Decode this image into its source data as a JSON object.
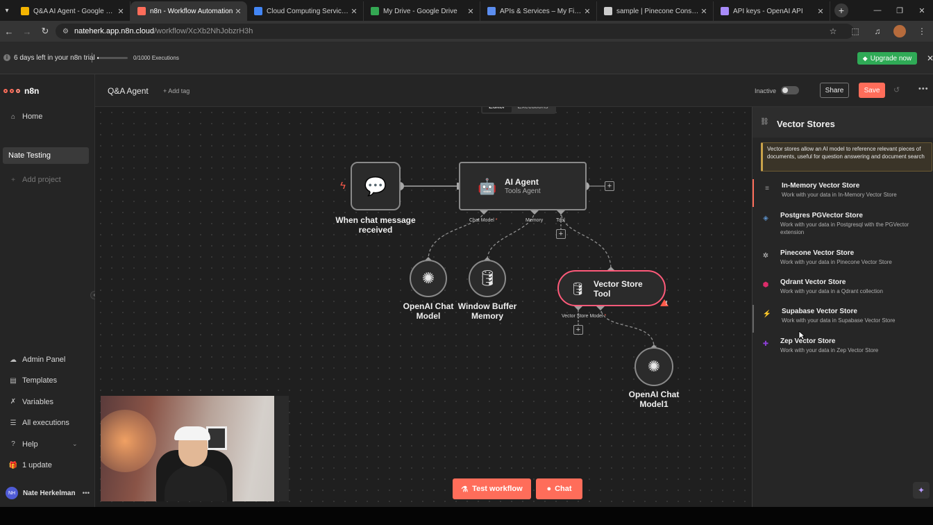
{
  "browser": {
    "tabs": [
      {
        "label": "Q&A AI Agent - Google Slides",
        "color": "#f4b400",
        "active": false
      },
      {
        "label": "n8n - Workflow Automation",
        "color": "#ff6d5a",
        "active": true
      },
      {
        "label": "Cloud Computing Services | Go",
        "color": "#4285f4",
        "active": false
      },
      {
        "label": "My Drive - Google Drive",
        "color": "#34a853",
        "active": false
      },
      {
        "label": "APIs & Services – My First Proje",
        "color": "#5b8def",
        "active": false
      },
      {
        "label": "sample | Pinecone Console",
        "color": "#cccccc",
        "active": false
      },
      {
        "label": "API keys - OpenAI API",
        "color": "#a88bfa",
        "active": false
      }
    ],
    "url_host": "nateherk.app.n8n.cloud",
    "url_path": "/workflow/XcXb2NhJobzrH3h"
  },
  "banner": {
    "trial_text": "6 days left in your n8n trial",
    "executions_text": "0/1000 Executions",
    "executions_fraction": 0.05,
    "upgrade_label": "Upgrade now"
  },
  "sidebar": {
    "brand": "n8n",
    "home": "Home",
    "project": "Nate Testing",
    "add_project": "Add project",
    "bottom_items": [
      {
        "label": "Admin Panel",
        "icon": "cloud-icon"
      },
      {
        "label": "Templates",
        "icon": "templates-icon"
      },
      {
        "label": "Variables",
        "icon": "variables-icon"
      },
      {
        "label": "All executions",
        "icon": "list-icon"
      },
      {
        "label": "Help",
        "icon": "help-icon"
      },
      {
        "label": "1 update",
        "icon": "gift-icon"
      }
    ],
    "user_initials": "NH",
    "user_name": "Nate Herkelman"
  },
  "header": {
    "workflow_name": "Q&A Agent",
    "add_tag": "+ Add tag",
    "status": "Inactive",
    "share": "Share",
    "save": "Save"
  },
  "canvas": {
    "tabs": [
      "Editor",
      "Executions"
    ],
    "nodes": {
      "trigger": "When chat message received",
      "agent_title": "AI Agent",
      "agent_subtitle": "Tools Agent",
      "chat_model": "OpenAI Chat Model",
      "memory": "Window Buffer Memory",
      "vector_tool": "Vector Store Tool",
      "chat_model1": "OpenAI Chat Model1"
    },
    "ports": {
      "chat_model": "Chat Model",
      "memory": "Memory",
      "tool": "Tool",
      "vector_store_model": "Vector Store Model",
      "required": "*"
    },
    "test_workflow": "Test workflow",
    "chat": "Chat"
  },
  "panel": {
    "title": "Vector Stores",
    "notice": "Vector stores allow an AI model to reference relevant pieces of documents, useful for question answering and document search",
    "items": [
      {
        "name": "In-Memory Vector Store",
        "desc": "Work with your data in In-Memory Vector Store",
        "color": "#9a9a9a",
        "glyph": "≡"
      },
      {
        "name": "Postgres PGVector Store",
        "desc": "Work with your data in Postgresql with the PGVector extension",
        "color": "#5b8fc7",
        "glyph": "◈"
      },
      {
        "name": "Pinecone Vector Store",
        "desc": "Work with your data in Pinecone Vector Store",
        "color": "#cfcfcf",
        "glyph": "✲"
      },
      {
        "name": "Qdrant Vector Store",
        "desc": "Work with your data in a Qdrant collection",
        "color": "#dc2c6a",
        "glyph": "⬢"
      },
      {
        "name": "Supabase Vector Store",
        "desc": "Work with your data in Supabase Vector Store",
        "color": "#3ecf8e",
        "glyph": "⚡"
      },
      {
        "name": "Zep Vector Store",
        "desc": "Work with your data in Zep Vector Store",
        "color": "#8d3fd8",
        "glyph": "✚"
      }
    ]
  }
}
